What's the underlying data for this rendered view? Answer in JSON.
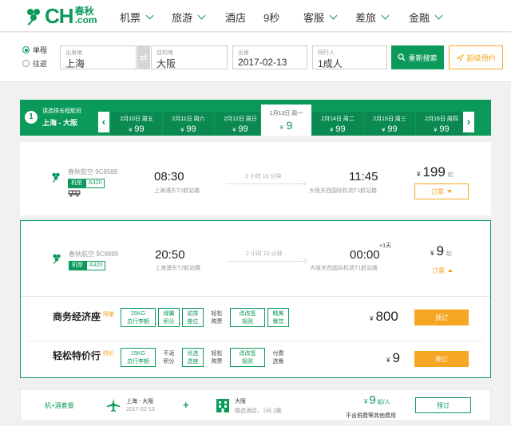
{
  "brand": {
    "word": "CH",
    "cn1": "春秋",
    "cn2": ".com",
    "color": "#0b9a5a"
  },
  "nav": [
    {
      "label": "机票",
      "chevron": true
    },
    {
      "label": "旅游",
      "chevron": true
    },
    {
      "label": "酒店",
      "chevron": false
    },
    {
      "label": "9秒",
      "chevron": false
    },
    {
      "label": "客服",
      "chevron": true
    },
    {
      "label": "差旅",
      "chevron": true
    },
    {
      "label": "金融",
      "chevron": true
    }
  ],
  "search": {
    "one_way": "单程",
    "round_trip": "往返",
    "from_label": "出发地",
    "from_value": "上海",
    "to_label": "目的地",
    "to_value": "大阪",
    "date_label": "出发",
    "date_value": "2017-02-13",
    "pax_label": "同行人",
    "pax_value": "1成人",
    "search_btn": "重新搜索",
    "super_btn": "超级预约",
    "swap_icon": "⇄"
  },
  "dates": {
    "step": "1",
    "step_title": "请选择去程航班",
    "route": "上海 - 大阪",
    "tabs": [
      {
        "date": "2月10日 周五",
        "price": "99"
      },
      {
        "date": "2月11日 周六",
        "price": "99"
      },
      {
        "date": "2月12日 周日",
        "price": "99"
      },
      {
        "date": "2月13日 周一",
        "price": "9",
        "selected": true
      },
      {
        "date": "2月14日 周二",
        "price": "99"
      },
      {
        "date": "2月15日 周三",
        "price": "99"
      },
      {
        "date": "2月16日 周四",
        "price": "99"
      }
    ],
    "currency": "¥"
  },
  "flight1": {
    "airline": "春秋航空 9C8589",
    "type_label": "机型",
    "type_value": "A320",
    "dep_time": "08:30",
    "dep_airport": "上海浦东T2航站楼",
    "duration": "2 小时 15 分钟",
    "arr_time": "11:45",
    "arr_airport": "大阪关西国际机场T1航站楼",
    "currency": "¥",
    "price": "199",
    "qi": "起",
    "book": "订票"
  },
  "flight2": {
    "airline": "春秋航空 9C8999",
    "type_label": "机型",
    "type_value": "A320",
    "dep_time": "20:50",
    "dep_airport": "上海浦东T2航站楼",
    "duration": "2 小时 10 分钟",
    "arr_time": "00:00",
    "next_day": "+1天",
    "arr_airport": "大阪关西国际机场T1航站楼",
    "currency": "¥",
    "price": "9",
    "qi": "起",
    "book": "订票"
  },
  "cabins": [
    {
      "name": "商务经济座",
      "tag": "限量",
      "features": [
        {
          "text": "25KG\n总行李额",
          "style": "g",
          "wide": true
        },
        {
          "text": "绿翼\n积分",
          "style": "g"
        },
        {
          "text": "前排\n座位",
          "style": "g"
        },
        {
          "text": "轻松\n购票",
          "style": "w"
        },
        {
          "text": "改改签\n规则",
          "style": "g",
          "wide": true
        },
        {
          "text": "精美\n餐饮",
          "style": "g"
        }
      ],
      "currency": "¥",
      "price": "800",
      "book": "预订"
    },
    {
      "name": "轻松特价行",
      "tag": "特价",
      "features": [
        {
          "text": "15KG\n总行李额",
          "style": "g",
          "wide": true
        },
        {
          "text": "不返\n积分",
          "style": "w"
        },
        {
          "text": "优选\n选座",
          "style": "g"
        },
        {
          "text": "轻松\n购票",
          "style": "w"
        },
        {
          "text": "改改签\n规则",
          "style": "g",
          "wide": true
        },
        {
          "text": "付费\n选餐",
          "style": "w"
        }
      ],
      "currency": "¥",
      "price": "9",
      "book": "预订"
    }
  ],
  "package": {
    "label": "机+酒套餐",
    "route": "上海 - 大阪",
    "date": "2017-02-13",
    "plus": "+",
    "hotel": "大阪",
    "hotel_sub": "精选酒店，1间 1晚",
    "currency": "¥",
    "price": "9",
    "unit": "起/人",
    "note": "不含税费等其他费用",
    "book": "预订"
  }
}
